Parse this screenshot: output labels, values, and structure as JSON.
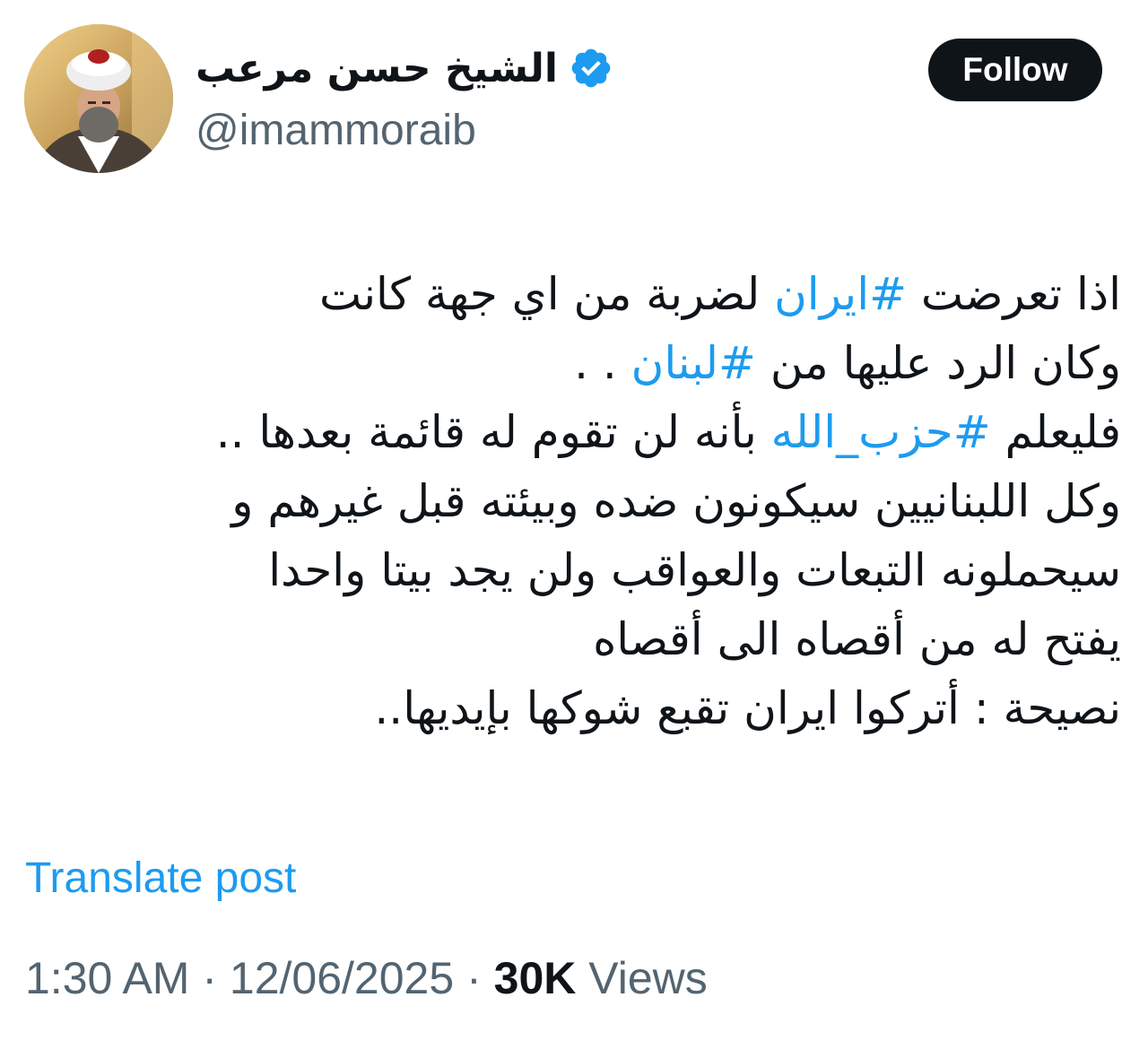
{
  "author": {
    "display_name": "الشيخ حسن مرعب",
    "handle": "@imammoraib",
    "verified": true,
    "verified_color": "#1d9bf0"
  },
  "follow_button": {
    "label": "Follow"
  },
  "tweet": {
    "lines": [
      [
        {
          "text": "اذا تعرضت "
        },
        {
          "text": "#ايران",
          "hashtag": true
        },
        {
          "text": " لضربة من اي جهة كانت"
        }
      ],
      [
        {
          "text": "وكان الرد عليها من "
        },
        {
          "text": "#لبنان",
          "hashtag": true
        },
        {
          "text": "  . ."
        }
      ],
      [
        {
          "text": "فليعلم "
        },
        {
          "text": "#حزب_الله",
          "hashtag": true
        },
        {
          "text": " بأنه لن تقوم له قائمة بعدها .."
        }
      ],
      [
        {
          "text": "وكل اللبنانيين سيكونون ضده وبيئته قبل غيرهم و"
        }
      ],
      [
        {
          "text": "سيحملونه التبعات والعواقب ولن يجد بيتا واحدا"
        }
      ],
      [
        {
          "text": "يفتح له من أقصاه الى أقصاه"
        }
      ],
      [
        {
          "text": "نصيحة : أتركوا ايران تقبع شوكها بإيديها.."
        }
      ]
    ]
  },
  "translate_link": {
    "label": "Translate post"
  },
  "meta": {
    "time": "1:30 AM",
    "separator": "·",
    "date": "12/06/2025",
    "views_count": "30K",
    "views_label": "Views"
  },
  "colors": {
    "text_primary": "#0f1419",
    "text_secondary": "#536471",
    "link": "#1d9bf0",
    "button_bg": "#0f1419",
    "button_text": "#ffffff"
  }
}
